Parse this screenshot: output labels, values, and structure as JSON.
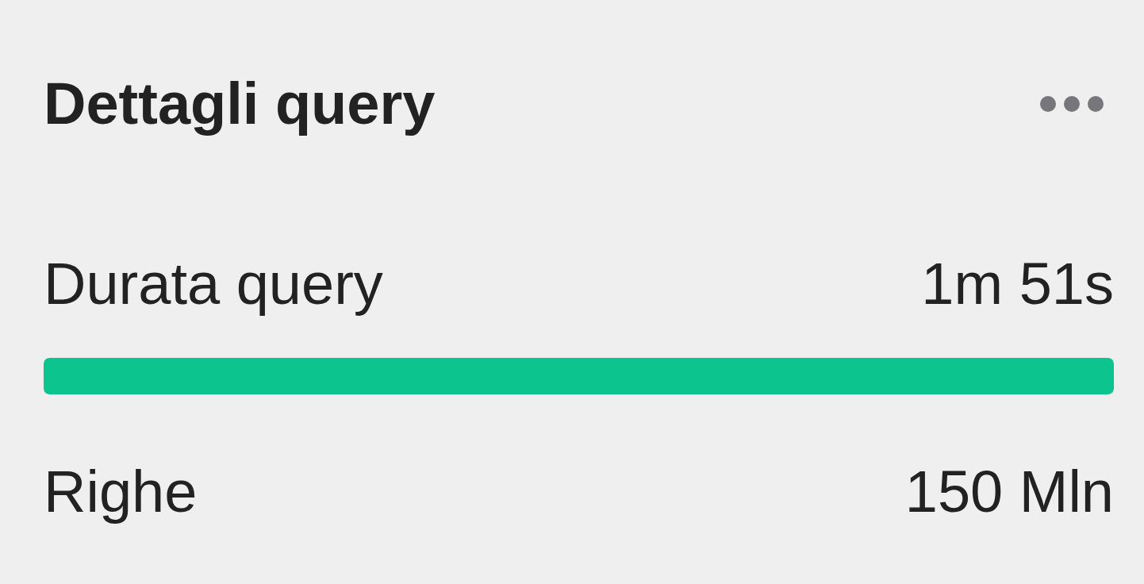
{
  "header": {
    "title": "Dettagli query"
  },
  "rows": [
    {
      "label": "Durata query",
      "value": "1m 51s",
      "level": 1
    },
    {
      "label": "Righe",
      "value": "150 Mln"
    }
  ]
}
